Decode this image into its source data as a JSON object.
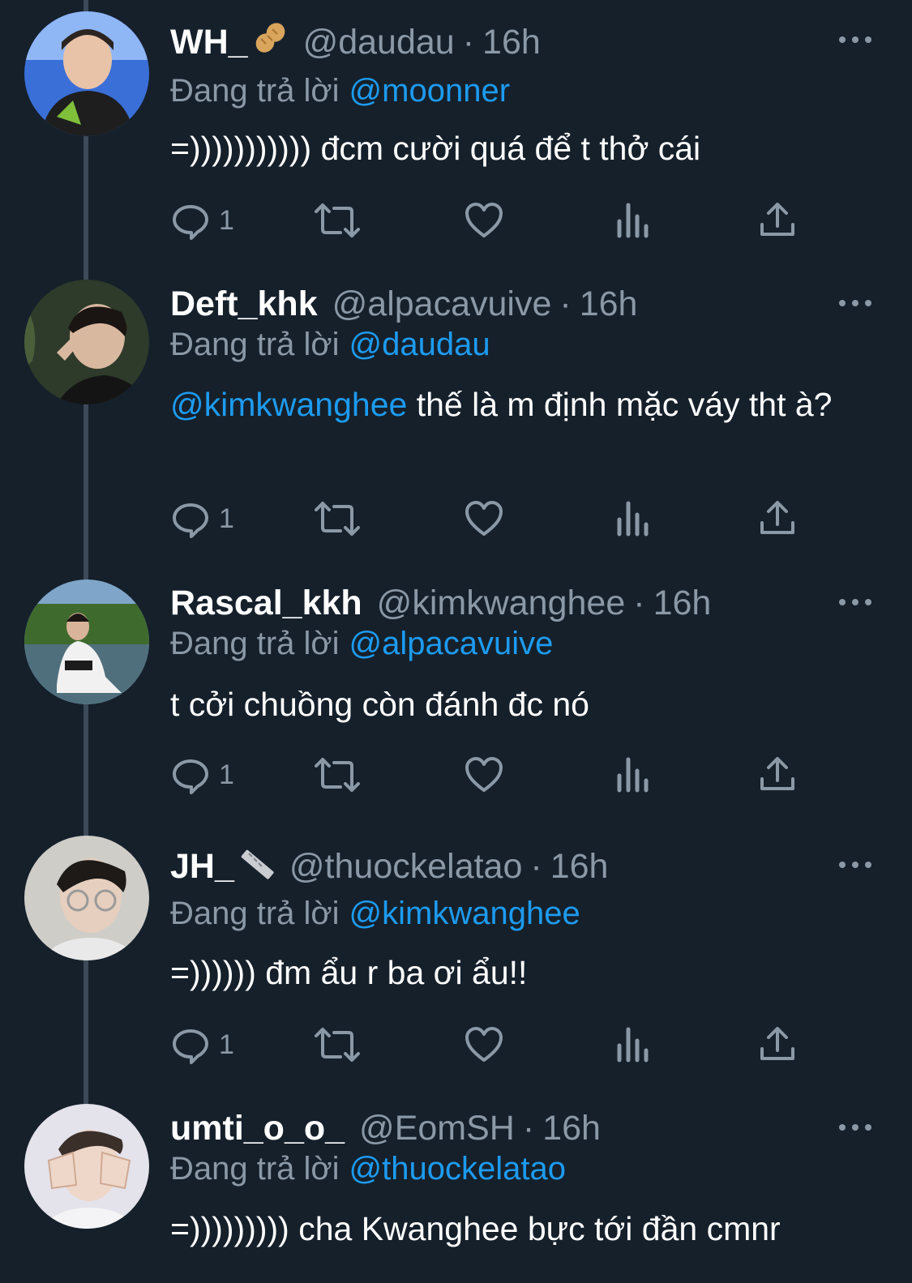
{
  "reply_prefix": "Đang trả lời",
  "tweets": [
    {
      "name": "WH_",
      "name_emoji": "peanut-icon",
      "handle": "@daudau",
      "time": "16h",
      "replying_to": "@moonner",
      "text": "=))))))))))) đcm cười quá để t thở cái",
      "text_mention": "",
      "reply_count": "1"
    },
    {
      "name": "Deft_khk",
      "name_emoji": "",
      "handle": "@alpacavuive",
      "time": "16h",
      "replying_to": "@daudau",
      "text_mention": "@kimkwanghee",
      "text": " thế là m định mặc váy tht à?",
      "reply_count": "1"
    },
    {
      "name": "Rascal_kkh",
      "name_emoji": "",
      "handle": "@kimkwanghee",
      "time": "16h",
      "replying_to": "@alpacavuive",
      "text_mention": "",
      "text": "t cởi chuồng còn đánh đc nó",
      "reply_count": "1"
    },
    {
      "name": "JH_",
      "name_emoji": "ruler-icon",
      "handle": "@thuockelatao",
      "time": "16h",
      "replying_to": "@kimkwanghee",
      "text_mention": "",
      "text": "=)))))) đm ẩu r ba ơi ẩu!!",
      "reply_count": "1"
    },
    {
      "name": "umti_o_o_",
      "name_emoji": "",
      "handle": "@EomSH",
      "time": "16h",
      "replying_to": "@thuockelatao",
      "text_mention": "",
      "text": "=))))))))) cha Kwanghee bực tới đần cmnr",
      "reply_count": ""
    }
  ],
  "colors": {
    "background": "#15202b",
    "secondary_text": "#8b98a5",
    "link": "#1d9bf0",
    "thread_line": "#3d4a58"
  }
}
